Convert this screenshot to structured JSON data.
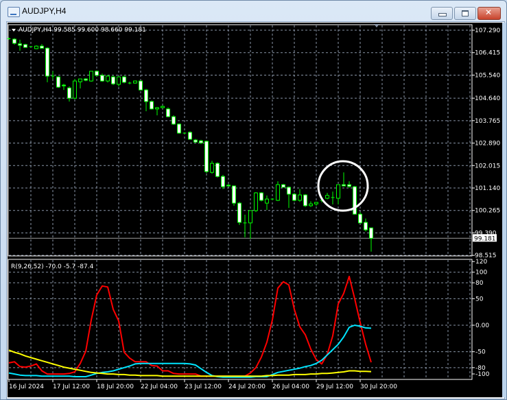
{
  "window": {
    "title": "AUDJPY,H4",
    "icon": "chart-window-icon",
    "buttons": [
      "minimize",
      "maximize",
      "close"
    ]
  },
  "chart": {
    "header": "AUDJPY,H4  99.585 99.600 98.660 99.181",
    "symbol": "AUDJPY",
    "timeframe": "H4",
    "ohlc_last": {
      "open": 99.585,
      "high": 99.6,
      "low": 98.66,
      "close": 99.181
    },
    "current_price_label": "99.181",
    "colors": {
      "background": "#000000",
      "candle_outline": "#00ff00",
      "bear_body": "#ffffff",
      "bull_body": "#000000",
      "grid": "#8a96a8",
      "price_line": "#a0a0a0",
      "annotation": "#ffffff"
    },
    "price_axis": [
      "107.290",
      "106.415",
      "105.540",
      "104.640",
      "103.765",
      "102.890",
      "102.015",
      "101.140",
      "100.265",
      "99.390",
      "98.515"
    ],
    "time_axis": [
      "16 Jul 2024",
      "17 Jul 12:00",
      "18 Jul 20:00",
      "22 Jul 04:00",
      "23 Jul 12:00",
      "24 Jul 20:00",
      "26 Jul 04:00",
      "29 Jul 12:00",
      "30 Jul 20:00"
    ],
    "annotation": "circle",
    "candles": [
      [
        106.96,
        107.0,
        106.92,
        106.94
      ],
      [
        106.94,
        106.98,
        106.73,
        106.78
      ],
      [
        106.76,
        106.92,
        106.49,
        106.7
      ],
      [
        106.73,
        106.76,
        106.62,
        106.62
      ],
      [
        106.65,
        106.67,
        106.62,
        106.63
      ],
      [
        106.57,
        106.7,
        106.55,
        106.67
      ],
      [
        106.67,
        106.75,
        106.57,
        106.59
      ],
      [
        106.59,
        106.62,
        105.26,
        105.5
      ],
      [
        105.5,
        105.69,
        105.37,
        105.48
      ],
      [
        105.47,
        105.5,
        105.04,
        105.07
      ],
      [
        105.15,
        105.2,
        104.96,
        105.12
      ],
      [
        105.04,
        105.1,
        104.51,
        104.64
      ],
      [
        104.64,
        105.39,
        104.6,
        105.31
      ],
      [
        105.28,
        105.4,
        105.02,
        105.39
      ],
      [
        105.39,
        105.42,
        105.3,
        105.34
      ],
      [
        105.31,
        105.69,
        105.28,
        105.69
      ],
      [
        105.69,
        105.72,
        105.5,
        105.53
      ],
      [
        105.53,
        105.6,
        105.28,
        105.31
      ],
      [
        105.31,
        105.55,
        105.25,
        105.5
      ],
      [
        105.47,
        105.52,
        105.15,
        105.2
      ],
      [
        105.18,
        105.5,
        105.1,
        105.47
      ],
      [
        105.47,
        105.52,
        105.22,
        105.26
      ],
      [
        105.23,
        105.28,
        105.18,
        105.23
      ],
      [
        105.23,
        105.33,
        105.2,
        105.31
      ],
      [
        105.31,
        105.34,
        104.94,
        104.96
      ],
      [
        104.96,
        105.0,
        104.13,
        104.51
      ],
      [
        104.51,
        104.55,
        104.2,
        104.22
      ],
      [
        104.22,
        104.3,
        103.97,
        104.27
      ],
      [
        104.27,
        104.36,
        104.25,
        104.32
      ],
      [
        104.22,
        104.28,
        103.9,
        103.92
      ],
      [
        103.92,
        103.97,
        103.6,
        103.63
      ],
      [
        103.63,
        103.66,
        103.25,
        103.28
      ],
      [
        103.28,
        103.31,
        103.25,
        103.28
      ],
      [
        103.31,
        103.35,
        103.02,
        103.04
      ],
      [
        103.01,
        103.05,
        102.9,
        102.93
      ],
      [
        102.98,
        103.02,
        102.85,
        102.9
      ],
      [
        102.96,
        102.99,
        101.72,
        101.78
      ],
      [
        101.75,
        102.2,
        101.7,
        102.1
      ],
      [
        102.1,
        102.14,
        101.55,
        101.59
      ],
      [
        101.59,
        101.65,
        101.1,
        101.19
      ],
      [
        101.25,
        101.3,
        101.2,
        101.22
      ],
      [
        101.22,
        101.24,
        100.45,
        100.55
      ],
      [
        100.55,
        100.6,
        99.7,
        99.8
      ],
      [
        99.78,
        100.1,
        99.22,
        99.78
      ],
      [
        99.78,
        100.26,
        99.16,
        100.26
      ],
      [
        100.26,
        100.98,
        100.2,
        100.95
      ],
      [
        100.95,
        100.98,
        100.62,
        100.66
      ],
      [
        100.55,
        100.85,
        100.28,
        100.71
      ],
      [
        100.71,
        100.73,
        100.66,
        100.69
      ],
      [
        100.66,
        101.4,
        100.63,
        101.27
      ],
      [
        101.27,
        101.3,
        101.17,
        101.17
      ],
      [
        101.17,
        101.2,
        100.36,
        100.9
      ],
      [
        100.9,
        100.95,
        100.62,
        100.66
      ],
      [
        100.66,
        101.1,
        100.6,
        100.87
      ],
      [
        100.87,
        100.9,
        100.4,
        100.45
      ],
      [
        100.45,
        100.62,
        100.4,
        100.52
      ],
      [
        100.52,
        100.6,
        100.45,
        100.58
      ],
      [
        100.66,
        100.8,
        100.58,
        100.66
      ],
      [
        100.74,
        100.95,
        100.7,
        100.85
      ],
      [
        100.77,
        101.0,
        100.5,
        100.77
      ],
      [
        100.74,
        101.25,
        100.5,
        101.27
      ],
      [
        101.27,
        101.75,
        101.2,
        101.22
      ],
      [
        101.27,
        101.4,
        101.15,
        101.2
      ],
      [
        101.19,
        101.22,
        100.1,
        100.12
      ],
      [
        100.12,
        100.2,
        99.75,
        99.78
      ],
      [
        99.8,
        99.95,
        99.45,
        99.51
      ],
      [
        99.585,
        99.6,
        98.66,
        99.181
      ]
    ]
  },
  "indicator": {
    "header": "R(9,26,52) -70.0 -5.7 -87.4",
    "axis": [
      "120",
      "100",
      "80",
      "50",
      "0.00",
      "-50",
      "-80",
      "-100"
    ],
    "axis_values": [
      120,
      100,
      80,
      50,
      0,
      -50,
      -80,
      -100
    ],
    "series": [
      {
        "color": "#ff0000",
        "values": [
          -71,
          -69,
          -78,
          -79,
          -77,
          -73,
          -86,
          -92,
          -92,
          -92,
          -92,
          -91,
          -88,
          -72,
          -49,
          10,
          57,
          74,
          72,
          30,
          8,
          -51,
          -62,
          -69,
          -69,
          -69,
          -76,
          -77,
          -86,
          -86,
          -91,
          -92,
          -92,
          -92,
          -92,
          -96,
          -96,
          -96,
          -96,
          -96,
          -96,
          -96,
          -96,
          -96,
          -90,
          -80,
          -60,
          -32,
          10,
          70,
          82,
          76,
          30,
          -3,
          -18,
          -45,
          -65,
          -73,
          -55,
          -20,
          40,
          60,
          92,
          50,
          5,
          -36,
          -70.0
        ]
      },
      {
        "color": "#00e5ff",
        "values": [
          -90,
          -92,
          -94,
          -95,
          -95,
          -95,
          -96,
          -96,
          -96,
          -96,
          -96,
          -96,
          -97,
          -97,
          -97,
          -94,
          -91,
          -89,
          -88,
          -86,
          -83,
          -80,
          -77,
          -73,
          -72,
          -72,
          -72,
          -72,
          -72,
          -72,
          -72,
          -72,
          -72,
          -73,
          -75,
          -82,
          -89,
          -95,
          -97,
          -98,
          -98,
          -98,
          -98,
          -98,
          -98,
          -97,
          -97,
          -97,
          -93,
          -89,
          -87,
          -85,
          -83,
          -81,
          -78,
          -76,
          -72,
          -66,
          -56,
          -46,
          -36,
          -22,
          -4,
          0,
          -2,
          -5,
          -5.7
        ]
      },
      {
        "color": "#ffff00",
        "values": [
          -47,
          -51,
          -54,
          -58,
          -61,
          -64,
          -67,
          -70,
          -73,
          -76,
          -79,
          -81,
          -83,
          -85,
          -87,
          -89,
          -90,
          -91,
          -92,
          -92,
          -93,
          -93,
          -94,
          -94,
          -95,
          -95,
          -95,
          -95,
          -96,
          -96,
          -96,
          -96,
          -96,
          -96,
          -96,
          -96,
          -96,
          -96,
          -96,
          -96,
          -96,
          -96,
          -96,
          -96,
          -96,
          -96,
          -96,
          -95,
          -95,
          -94,
          -94,
          -94,
          -93,
          -93,
          -93,
          -92,
          -92,
          -91,
          -91,
          -90,
          -89,
          -88,
          -86,
          -86,
          -87,
          -87,
          -87.4
        ]
      }
    ]
  }
}
